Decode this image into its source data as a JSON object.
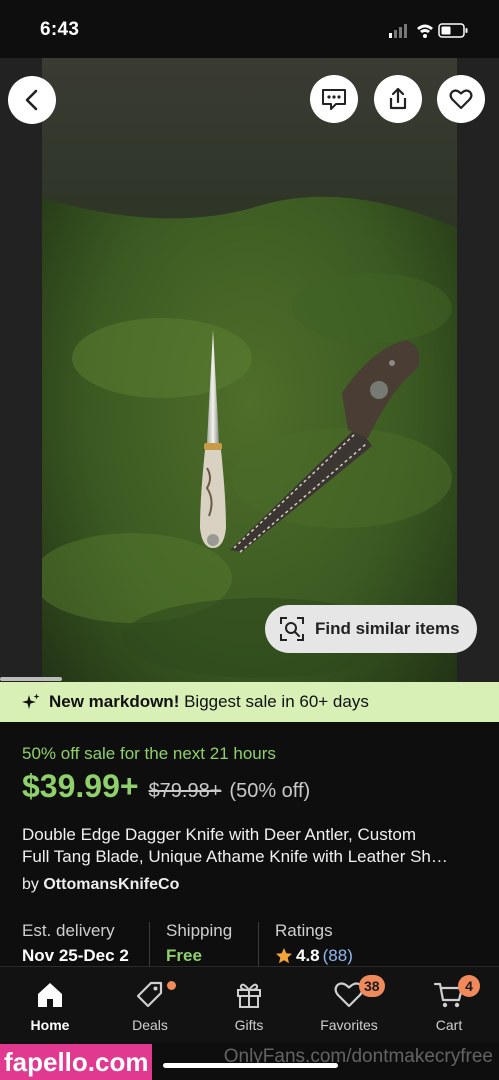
{
  "status": {
    "time": "6:43"
  },
  "hero": {
    "nav": {
      "back": "chevron-left-icon",
      "message": "message-icon",
      "share": "share-icon",
      "favorite": "heart-icon"
    },
    "find_similar_label": "Find similar items"
  },
  "banner": {
    "strong": "New markdown!",
    "text": " Biggest sale in 60+ days"
  },
  "sale": {
    "countdown": "50% off sale for the next 21 hours",
    "price": "$39.99+",
    "old_price": "$79.98+",
    "discount": "(50% off)"
  },
  "listing": {
    "title_line1": "Double Edge Dagger Knife with Deer Antler, Custom",
    "title_line2": "Full Tang Blade, Unique Athame Knife with Leather Sh…",
    "seller_prefix": "by ",
    "seller_name": "OttomansKnifeCo"
  },
  "info": {
    "delivery_label": "Est. delivery",
    "delivery_value": "Nov 25-Dec 2",
    "shipping_label": "Shipping",
    "shipping_value": "Free",
    "ratings_label": "Ratings",
    "rating_value": "4.8",
    "rating_count": "(88)"
  },
  "tabs": [
    {
      "label": "Home",
      "icon": "home-icon"
    },
    {
      "label": "Deals",
      "icon": "tag-icon"
    },
    {
      "label": "Gifts",
      "icon": "gift-icon"
    },
    {
      "label": "Favorites",
      "icon": "heart-icon",
      "badge": "38"
    },
    {
      "label": "Cart",
      "icon": "cart-icon",
      "badge": "4"
    }
  ],
  "watermarks": {
    "left": "fapello.com",
    "right": "OnlyFans.com/dontmakecryfree"
  },
  "colors": {
    "accent_green": "#8fd06a",
    "banner_bg": "#d8f0b5",
    "badge": "#f08a5a"
  }
}
